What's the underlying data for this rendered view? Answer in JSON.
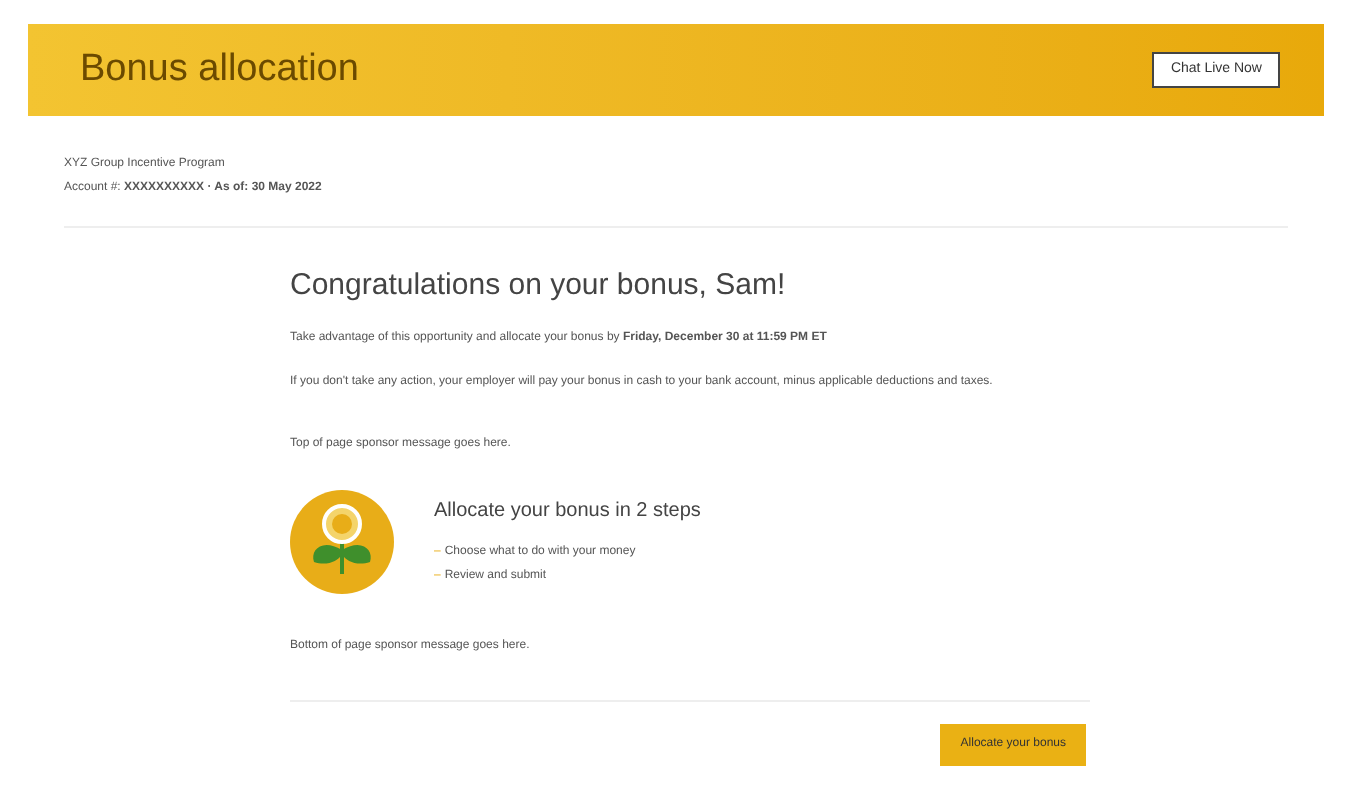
{
  "header": {
    "title": "Bonus allocation",
    "chat_button": "Chat Live Now"
  },
  "account": {
    "program": "XYZ Group Incentive Program",
    "details": "Account #: **XXXXXXXXXX · As of: 30 May 2022**"
  },
  "main": {
    "heading": "Congratulations on your bonus, Sam!",
    "paragraphs": [
      "Take advantage of this opportunity and allocate your bonus by **Friday, December 30 at 11:59 PM ET**",
      "If you don't take any action, your employer will pay your bonus in cash to your bank account, minus applicable deductions and taxes."
    ],
    "top_message": "Top of page sponsor message goes here.",
    "steps": {
      "title": "Allocate your bonus in 2 steps",
      "items": [
        {
          "marker": "–",
          "text": "Choose what to do with your money"
        },
        {
          "marker": "–",
          "text": "Review and submit"
        }
      ]
    },
    "bottom_message": "Bottom of page sponsor message goes here.",
    "action_button": "Allocate your bonus"
  }
}
